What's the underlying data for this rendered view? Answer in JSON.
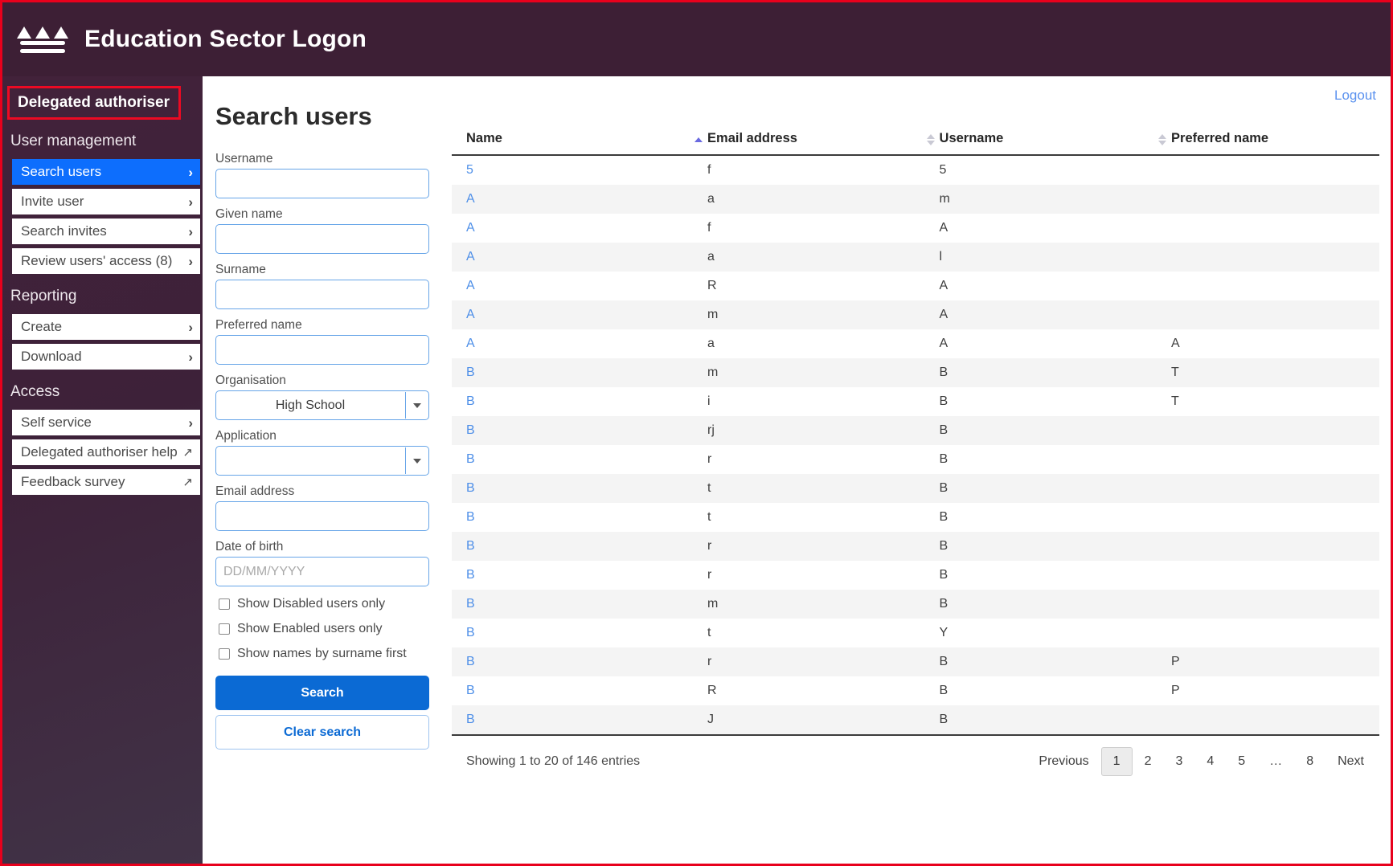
{
  "header": {
    "title": "Education Sector Logon",
    "logo_icon": "mountains-waves-icon"
  },
  "sidebar": {
    "role_label": "Delegated authoriser",
    "groups": [
      {
        "label": "User management",
        "items": [
          {
            "label": "Search users",
            "icon": "chevron-right-icon",
            "active": true
          },
          {
            "label": "Invite user",
            "icon": "chevron-right-icon",
            "active": false
          },
          {
            "label": "Search invites",
            "icon": "chevron-right-icon",
            "active": false
          },
          {
            "label": "Review users' access (8)",
            "icon": "chevron-right-icon",
            "active": false
          }
        ]
      },
      {
        "label": "Reporting",
        "items": [
          {
            "label": "Create",
            "icon": "chevron-right-icon",
            "active": false
          },
          {
            "label": "Download",
            "icon": "chevron-right-icon",
            "active": false
          }
        ]
      },
      {
        "label": "Access",
        "items": [
          {
            "label": "Self service",
            "icon": "chevron-right-icon",
            "active": false
          },
          {
            "label": "Delegated authoriser help",
            "icon": "external-link-icon",
            "active": false
          },
          {
            "label": "Feedback survey",
            "icon": "external-link-icon",
            "active": false
          }
        ]
      }
    ]
  },
  "main": {
    "page_title": "Search users",
    "logout_label": "Logout"
  },
  "search_form": {
    "fields": [
      {
        "label": "Username",
        "value": "",
        "placeholder": "",
        "type": "text"
      },
      {
        "label": "Given name",
        "value": "",
        "placeholder": "",
        "type": "text"
      },
      {
        "label": "Surname",
        "value": "",
        "placeholder": "",
        "type": "text"
      },
      {
        "label": "Preferred name",
        "value": "",
        "placeholder": "",
        "type": "text"
      },
      {
        "label": "Organisation",
        "value": "High School",
        "placeholder": "",
        "type": "select"
      },
      {
        "label": "Application",
        "value": "",
        "placeholder": "",
        "type": "select"
      },
      {
        "label": "Email address",
        "value": "",
        "placeholder": "",
        "type": "text"
      },
      {
        "label": "Date of birth",
        "value": "",
        "placeholder": "DD/MM/YYYY",
        "type": "text"
      }
    ],
    "checkboxes": [
      {
        "label": "Show Disabled users only",
        "checked": false
      },
      {
        "label": "Show Enabled users only",
        "checked": false
      },
      {
        "label": "Show names by surname first",
        "checked": false
      }
    ],
    "search_button": "Search",
    "clear_button": "Clear search"
  },
  "results_table": {
    "columns": [
      {
        "label": "Name",
        "sort": "asc"
      },
      {
        "label": "Email address",
        "sort": "none"
      },
      {
        "label": "Username",
        "sort": "none"
      },
      {
        "label": "Preferred name",
        "sort": "none"
      }
    ],
    "rows": [
      {
        "name": "5",
        "email": "f",
        "username": "5",
        "preferred": ""
      },
      {
        "name": "A",
        "email": "a",
        "username": "m",
        "preferred": ""
      },
      {
        "name": "A",
        "email": "f",
        "username": "A",
        "preferred": ""
      },
      {
        "name": "A",
        "email": "a",
        "username": "l",
        "preferred": ""
      },
      {
        "name": "A",
        "email": "R",
        "username": "A",
        "preferred": ""
      },
      {
        "name": "A",
        "email": "m",
        "username": "A",
        "preferred": ""
      },
      {
        "name": "A",
        "email": "a",
        "username": "A",
        "preferred": "A"
      },
      {
        "name": "B",
        "email": "m",
        "username": "B",
        "preferred": "T"
      },
      {
        "name": "B",
        "email": "i",
        "username": "B",
        "preferred": "T"
      },
      {
        "name": "B",
        "email": "rj",
        "username": "B",
        "preferred": ""
      },
      {
        "name": "B",
        "email": "r",
        "username": "B",
        "preferred": ""
      },
      {
        "name": "B",
        "email": "t",
        "username": "B",
        "preferred": ""
      },
      {
        "name": "B",
        "email": "t",
        "username": "B",
        "preferred": ""
      },
      {
        "name": "B",
        "email": "r",
        "username": "B",
        "preferred": ""
      },
      {
        "name": "B",
        "email": "r",
        "username": "B",
        "preferred": ""
      },
      {
        "name": "B",
        "email": "m",
        "username": "B",
        "preferred": ""
      },
      {
        "name": "B",
        "email": "t",
        "username": "Y",
        "preferred": ""
      },
      {
        "name": "B",
        "email": "r",
        "username": "B",
        "preferred": "P"
      },
      {
        "name": "B",
        "email": "R",
        "username": "B",
        "preferred": "P"
      },
      {
        "name": "B",
        "email": "J",
        "username": "B",
        "preferred": ""
      }
    ],
    "entries_info": "Showing 1 to 20 of 146 entries",
    "pagination": {
      "previous_label": "Previous",
      "next_label": "Next",
      "pages": [
        "1",
        "2",
        "3",
        "4",
        "5",
        "…",
        "8"
      ],
      "current": "1"
    }
  },
  "colors": {
    "header_bg": "#3d1f35",
    "sidebar_bg": "#42223a",
    "accent_blue": "#0d6efd",
    "link_blue": "#4e8fe8",
    "highlight_red": "#ec0a23"
  }
}
